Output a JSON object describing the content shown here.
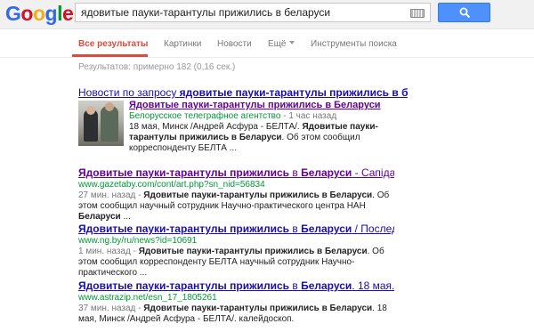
{
  "header": {
    "logo_letters": [
      "G",
      "o",
      "o",
      "g",
      "l",
      "e"
    ],
    "logo_colors": [
      "#3369e8",
      "#d50f25",
      "#eeb211",
      "#3369e8",
      "#009925",
      "#d50f25"
    ],
    "search_query": "ядовитые пауки-тарантулы прижились в беларуси",
    "search_button_icon": "magnifier-icon",
    "keyboard_icon": "keyboard-icon"
  },
  "nav": {
    "tabs": [
      "Все результаты",
      "Картинки",
      "Новости",
      "Ещё",
      "Инструменты поиска"
    ],
    "active_tab_color": "#dd4b39"
  },
  "stats": "Результатов: примерно 182 (0,16 сек.)",
  "news": {
    "heading_prefix": "Новости по запросу ",
    "heading_query": "ядовитые пауки-тарантулы прижились в б...",
    "item_title": "Ядовитые пауки-тарантулы прижились в Беларуси",
    "source": "Белорусское телеграфное агентство",
    "time": " - 1 час назад",
    "snippet_1": "18 мая, Минск /Андрей Асфура - БЕЛТА/. ",
    "snippet_bold": "Ядовитые пауки-тарантулы прижились в Беларуси",
    "snippet_2": ". Об этом сообщил корреспонденту БЕЛТА ..."
  },
  "results": [
    {
      "title_bold": "Ядовитые пауки-тарантулы прижились",
      "title_mid": " в ",
      "title_bold2": "Беларуси",
      "title_rest": " - Сапідар...",
      "url": "www.gazetaby.com/cont/art.php?sn_nid=56834",
      "age": "27 мин. назад - ",
      "desc_bold": "Ядовитые пауки-тарантулы прижились в Беларуси",
      "desc_rest": ". Об этом сообщил научный сотрудник Научно-практического центра НАН ",
      "desc_bold2": "Беларуси",
      "desc_end": " ..."
    },
    {
      "title_bold": "Ядовитые пауки-тарантулы прижились",
      "title_mid": " в ",
      "title_bold2": "Беларуси",
      "title_rest": " / Последн...",
      "url": "www.ng.by/ru/news?id=10691",
      "age": "1 мин. назад - ",
      "desc_bold": "Ядовитые пауки-тарантулы прижились в Беларуси",
      "desc_rest": ". Об этом сообщил корреспонденту БЕЛТА научный сотрудник Научно-практического ...",
      "desc_bold2": "",
      "desc_end": ""
    },
    {
      "title_bold": "Ядовитые пауки-тарантулы прижились",
      "title_mid": " в ",
      "title_bold2": "Беларуси",
      "title_rest": ". 18 мая...",
      "url": "www.astrazip.net/esn_17_1805261",
      "age": "37 мин. назад - ",
      "desc_bold": "Ядовитые пауки-тарантулы прижились в Беларуси",
      "desc_rest": ". 18 мая, Минск /Андрей Асфура - БЕЛТА/. калейдоскоп.",
      "desc_bold2": "",
      "desc_end": ""
    }
  ]
}
